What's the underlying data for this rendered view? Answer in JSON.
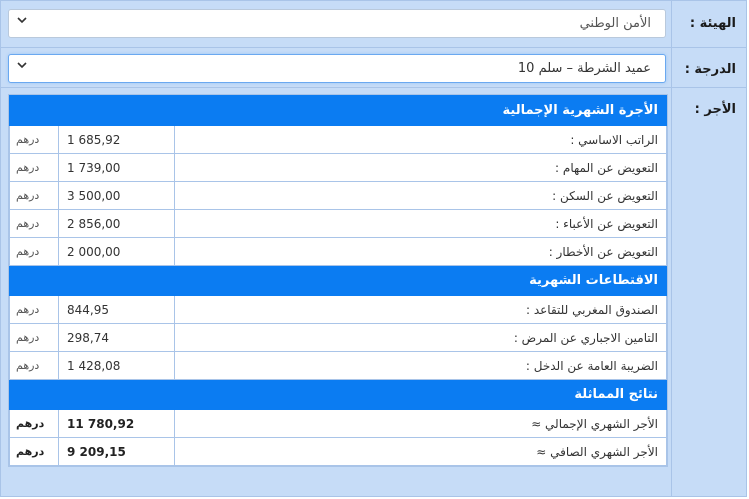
{
  "form": {
    "agency_label": "الهيئة :",
    "grade_label": "الدرجة :",
    "pay_label": "الأجر :",
    "agency_value": "الأمن الوطني",
    "grade_value": "عميد الشرطة – سلم 10"
  },
  "sections": {
    "gross_title": "الأجرة الشهرية الإجمالية",
    "deductions_title": "الاقتطاعات الشهرية",
    "results_title": "نتائج المماثلة"
  },
  "gross_rows": [
    {
      "label": "الراتب الاساسي :",
      "value": "1 685,92",
      "unit": "درهم"
    },
    {
      "label": "التعويض عن المهام :",
      "value": "1 739,00",
      "unit": "درهم"
    },
    {
      "label": "التعويض عن السكن :",
      "value": "3 500,00",
      "unit": "درهم"
    },
    {
      "label": "التعويض عن الأعباء :",
      "value": "2 856,00",
      "unit": "درهم"
    },
    {
      "label": "التعويض عن الأخطار :",
      "value": "2 000,00",
      "unit": "درهم"
    }
  ],
  "deduction_rows": [
    {
      "label": "الصندوق المغربي للتقاعد :",
      "value": "844,95",
      "unit": "درهم"
    },
    {
      "label": "التامين الاجباري عن المرض :",
      "value": "298,74",
      "unit": "درهم"
    },
    {
      "label": "الضريبة العامة عن الدخل :",
      "value": "1 428,08",
      "unit": "درهم"
    }
  ],
  "result_rows": [
    {
      "label": "الأجر الشهري الإجمالي ≈",
      "value": "11 780,92",
      "unit": "درهم"
    },
    {
      "label": "الأجر الشهري الصافي ≈",
      "value": "9 209,15",
      "unit": "درهم"
    }
  ],
  "colors": {
    "section_header": "#0b7cf2",
    "label_bg": "#c6dcf7",
    "border": "#a9c4e8"
  },
  "icons": [
    "chevron-down-icon"
  ]
}
